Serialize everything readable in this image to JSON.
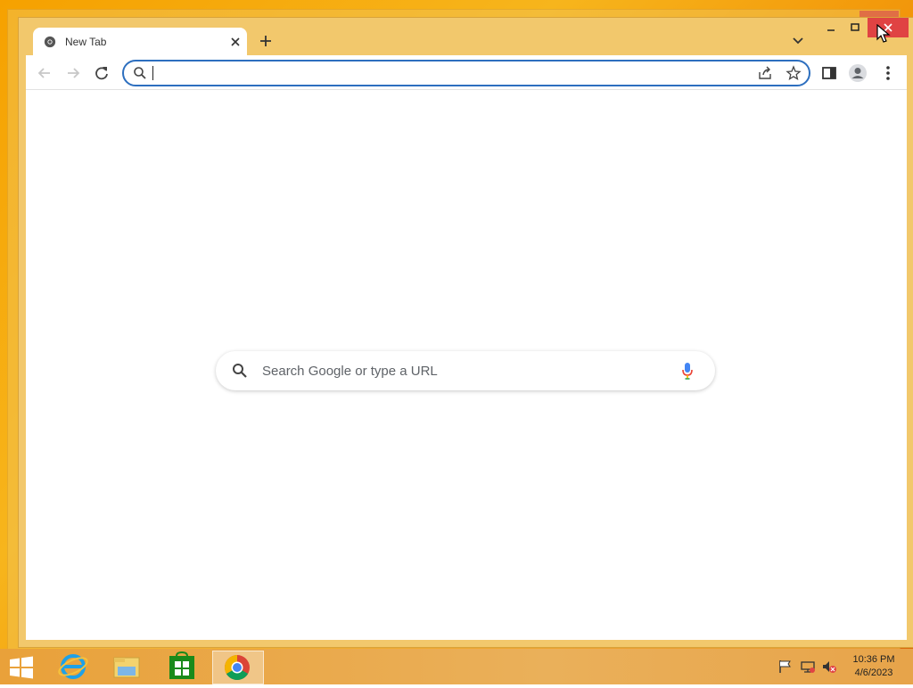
{
  "browser": {
    "tab": {
      "title": "New Tab"
    },
    "omnibox": {
      "value": "",
      "placeholder": ""
    },
    "ntp": {
      "search_placeholder": "Search Google or type a URL"
    }
  },
  "taskbar": {
    "clock_time": "10:36 PM",
    "clock_date": "4/6/2023",
    "apps": [
      "internet-explorer",
      "file-explorer",
      "store",
      "chrome"
    ]
  },
  "colors": {
    "accent": "#2d6fbf",
    "window_frame": "#f2c86c",
    "close_button": "#e04343",
    "desktop": "#f6a100"
  }
}
